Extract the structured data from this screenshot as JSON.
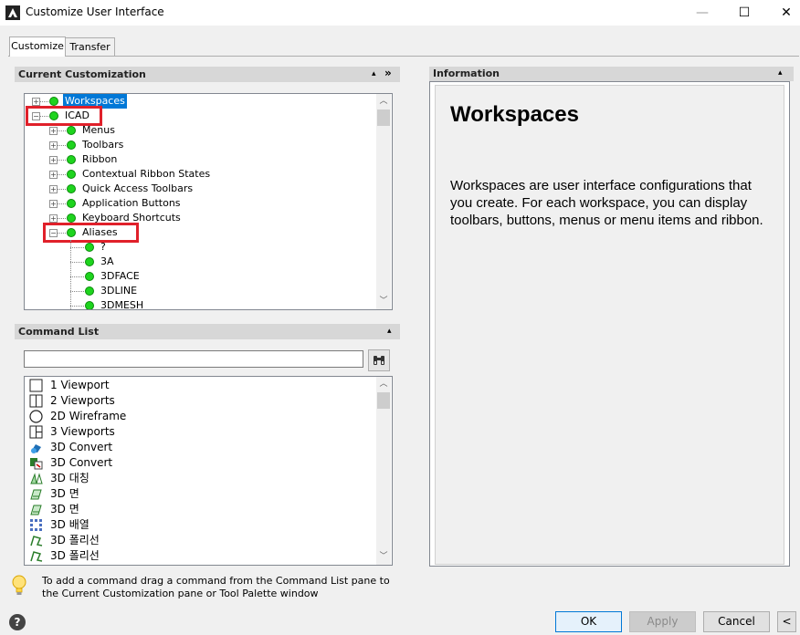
{
  "window": {
    "title": "Customize User Interface",
    "minimize": "—",
    "maximize": "☐",
    "close": "✕"
  },
  "tabs": [
    {
      "label": "Customize"
    },
    {
      "label": "Transfer"
    }
  ],
  "current_customization": {
    "header": "Current Customization",
    "collapse": "▴",
    "expand_more": "»",
    "tree": [
      {
        "label": "Workspaces",
        "level": 0,
        "expander": "+",
        "selected": true
      },
      {
        "label": "ICAD",
        "level": 0,
        "expander": "−",
        "highlighted": true
      },
      {
        "label": "Menus",
        "level": 1,
        "expander": "+"
      },
      {
        "label": "Toolbars",
        "level": 1,
        "expander": "+"
      },
      {
        "label": "Ribbon",
        "level": 1,
        "expander": "+"
      },
      {
        "label": "Contextual Ribbon States",
        "level": 1,
        "expander": "+"
      },
      {
        "label": "Quick Access Toolbars",
        "level": 1,
        "expander": "+"
      },
      {
        "label": "Application Buttons",
        "level": 1,
        "expander": "+"
      },
      {
        "label": "Keyboard Shortcuts",
        "level": 1,
        "expander": "+"
      },
      {
        "label": "Aliases",
        "level": 1,
        "expander": "−",
        "highlighted": true
      },
      {
        "label": "?",
        "level": 2
      },
      {
        "label": "3A",
        "level": 2
      },
      {
        "label": "3DFACE",
        "level": 2
      },
      {
        "label": "3DLINE",
        "level": 2
      },
      {
        "label": "3DMESH",
        "level": 2
      }
    ]
  },
  "command_list": {
    "header": "Command List",
    "collapse": "▴",
    "search_value": "",
    "search_placeholder": "",
    "items": [
      {
        "label": "1 Viewport",
        "icon": "single-viewport-icon"
      },
      {
        "label": "2 Viewports",
        "icon": "two-viewports-icon"
      },
      {
        "label": "2D Wireframe",
        "icon": "wireframe-circle-icon"
      },
      {
        "label": "3 Viewports",
        "icon": "three-viewports-icon"
      },
      {
        "label": "3D Convert",
        "icon": "3d-convert-icon"
      },
      {
        "label": "3D Convert",
        "icon": "3d-convert-alt-icon"
      },
      {
        "label": "3D 대칭",
        "icon": "3d-mirror-icon"
      },
      {
        "label": "3D 면",
        "icon": "3d-face-icon"
      },
      {
        "label": "3D 면",
        "icon": "3d-face-icon"
      },
      {
        "label": "3D 배열",
        "icon": "3d-array-icon"
      },
      {
        "label": "3D 폴리선",
        "icon": "3d-polyline-icon"
      },
      {
        "label": "3D 폴리선",
        "icon": "3d-polyline-icon"
      }
    ]
  },
  "information": {
    "header": "Information",
    "collapse": "▴",
    "title": "Workspaces",
    "description": "Workspaces are user interface configurations that you create. For each workspace, you can display toolbars, buttons, menus or menu items and ribbon."
  },
  "hint": {
    "text_line1": "To add a command drag a command from the Command List pane to",
    "text_line2": "the Current Customization pane or Tool Palette window"
  },
  "footer": {
    "help": "?",
    "ok": "OK",
    "apply": "Apply",
    "cancel": "Cancel",
    "collapse": "<"
  },
  "colors": {
    "accent": "#0078d7",
    "highlight_box": "#e0202a",
    "status_dot": "#1ed41e"
  }
}
